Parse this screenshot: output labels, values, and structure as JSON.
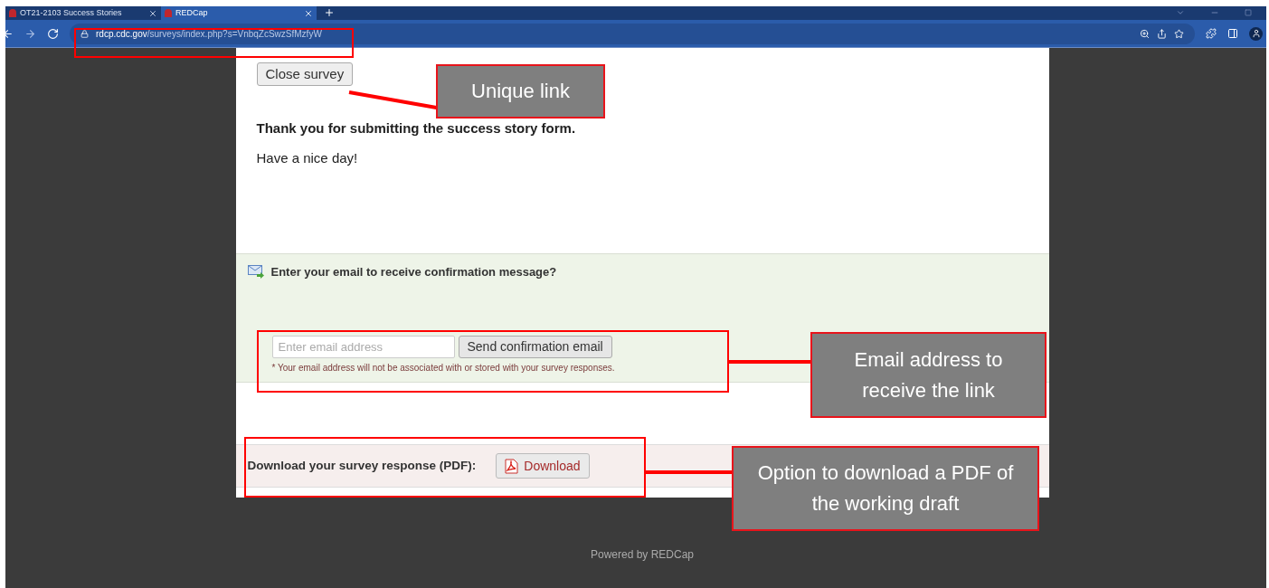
{
  "browser": {
    "tabs": [
      {
        "label": "OT21-2103 Success Stories",
        "selected": false
      },
      {
        "label": "REDCap",
        "selected": true
      }
    ],
    "address": {
      "host": "rdcp.cdc.gov",
      "path": "/surveys/index.php?s=VnbqZcSwzSfMzfyW"
    }
  },
  "survey": {
    "close_button": "Close survey",
    "heading": "Thank you for submitting the success story form.",
    "message": "Have a nice day!",
    "email": {
      "prompt": "Enter your email to receive confirmation message?",
      "placeholder": "Enter email address",
      "button": "Send confirmation email",
      "note": "* Your email address will not be associated with or stored with your survey responses."
    },
    "download": {
      "label": "Download your survey response (PDF):",
      "button": "Download"
    }
  },
  "footer": "Powered by REDCap",
  "annotations": [
    {
      "kind": "link",
      "text": "Unique link"
    },
    {
      "kind": "email",
      "text": "Email address to receive the link"
    },
    {
      "kind": "download",
      "text": "Option to download a PDF of the working draft"
    }
  ]
}
